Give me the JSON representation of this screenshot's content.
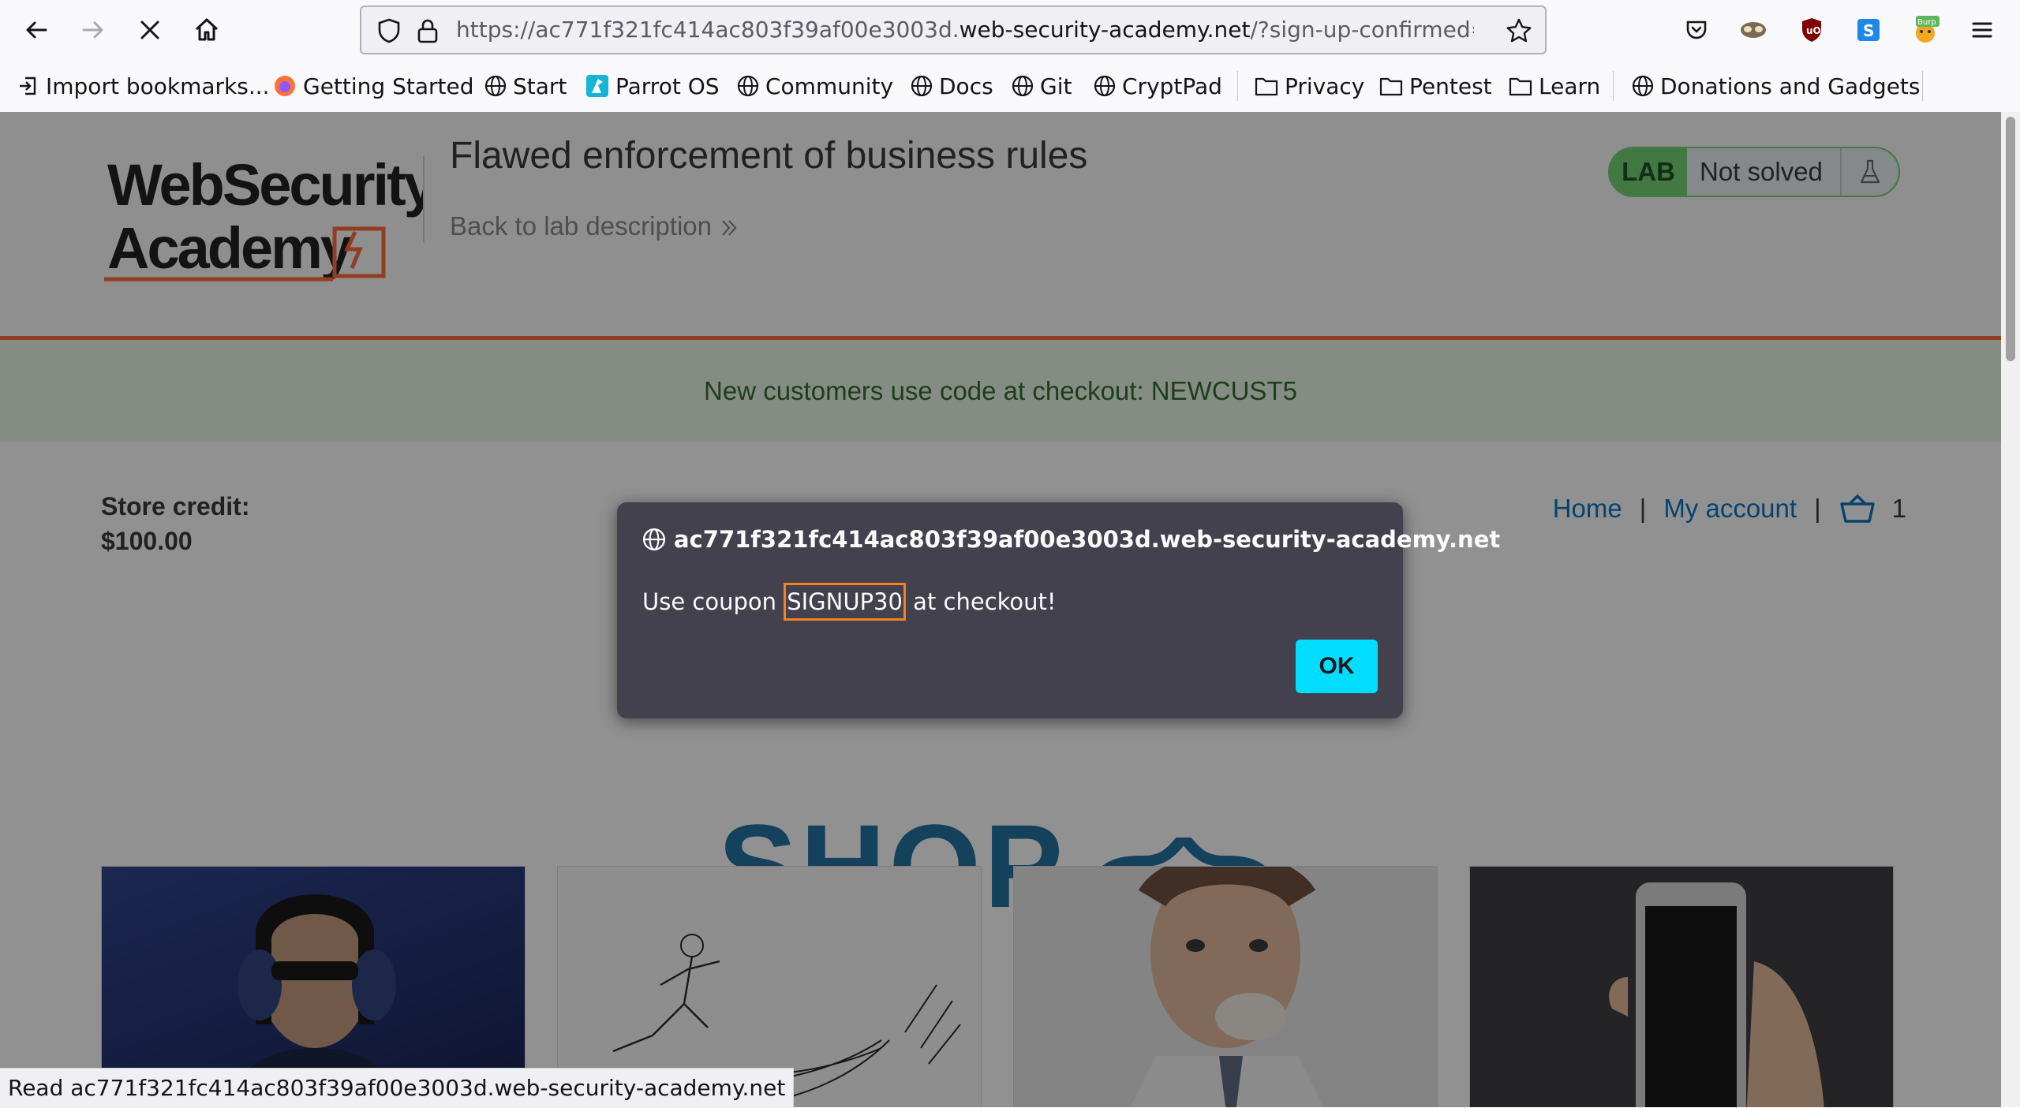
{
  "browser": {
    "url_prefix": "https://ac771f321fc414ac803f39af00e3003d.",
    "url_domain": "web-security-academy.net",
    "url_suffix": "/?sign-up-confirmed=t",
    "extensions": [
      "pocket-icon",
      "mask-icon",
      "ublock-icon",
      "s-extension-icon",
      "burp-icon"
    ],
    "burp_label": "Burp"
  },
  "bookmarks": [
    {
      "label": "Import bookmarks...",
      "icon": "import-icon"
    },
    {
      "label": "Getting Started",
      "icon": "firefox-icon"
    },
    {
      "label": "Start",
      "icon": "globe-icon"
    },
    {
      "label": "Parrot OS",
      "icon": "parrot-icon"
    },
    {
      "label": "Community",
      "icon": "globe-icon"
    },
    {
      "label": "Docs",
      "icon": "globe-icon"
    },
    {
      "label": "Git",
      "icon": "globe-icon"
    },
    {
      "label": "CryptPad",
      "icon": "globe-icon"
    },
    {
      "label": "Privacy",
      "icon": "folder-icon"
    },
    {
      "label": "Pentest",
      "icon": "folder-icon"
    },
    {
      "label": "Learn",
      "icon": "folder-icon"
    },
    {
      "label": "Donations and Gadgets",
      "icon": "globe-icon"
    }
  ],
  "lab": {
    "logo_line1": "WebSecurity",
    "logo_line2": "Academy",
    "title": "Flawed enforcement of business rules",
    "back_link": "Back to lab description",
    "badge": "LAB",
    "status": "Not solved"
  },
  "notice": "New customers use code at checkout: NEWCUST5",
  "store": {
    "credit_label": "Store credit:",
    "credit_value": "$100.00",
    "nav_home": "Home",
    "nav_sep": "|",
    "nav_account": "My account",
    "cart_count": "1",
    "shop_logo": "SHOP"
  },
  "dialog": {
    "host": "ac771f321fc414ac803f39af00e3003d.web-security-academy.net",
    "msg_before": "Use coupon ",
    "code": "SIGNUP30",
    "msg_after": " at checkout!",
    "ok_label": "OK"
  },
  "statusbar": "Read ac771f321fc414ac803f39af00e3003d.web-security-academy.net"
}
